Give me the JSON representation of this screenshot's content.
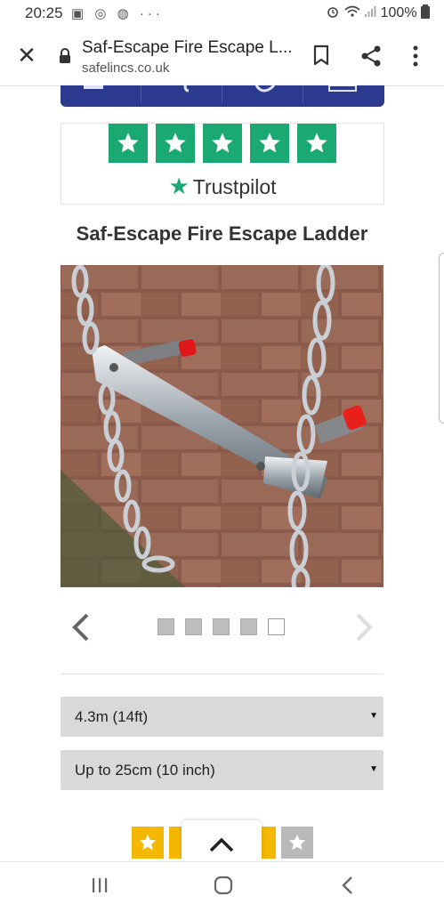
{
  "status_bar": {
    "time": "20:25",
    "left_icons": [
      "gallery-icon",
      "whatsapp-icon",
      "chrome-icon",
      "more-dots-icon"
    ],
    "left_icon_glyphs": "▣ ◎ ◍ ···",
    "battery": "100%"
  },
  "browser": {
    "page_title": "Saf-Escape Fire Escape L...",
    "url": "safelincs.co.uk",
    "close_glyph": "✕"
  },
  "trustpilot": {
    "stars": 5,
    "brand": "Trustpilot",
    "brand_star": "★"
  },
  "product": {
    "title": "Saf-Escape Fire Escape Ladder",
    "image_alt": "Fire escape ladder with chains and red-capped standoffs against brick wall"
  },
  "carousel": {
    "slide_count": 5,
    "active_index": 4
  },
  "options": {
    "length": {
      "value": "4.3m (14ft)",
      "caret": "▼"
    },
    "sill": {
      "value": "Up to 25cm (10 inch)",
      "caret": "▼"
    }
  },
  "colors": {
    "trustpilot_green": "#1aa972",
    "nav_blue": "#2b3a8f",
    "rating_gold": "#f5b800",
    "rating_grey": "#b9b9b9"
  }
}
